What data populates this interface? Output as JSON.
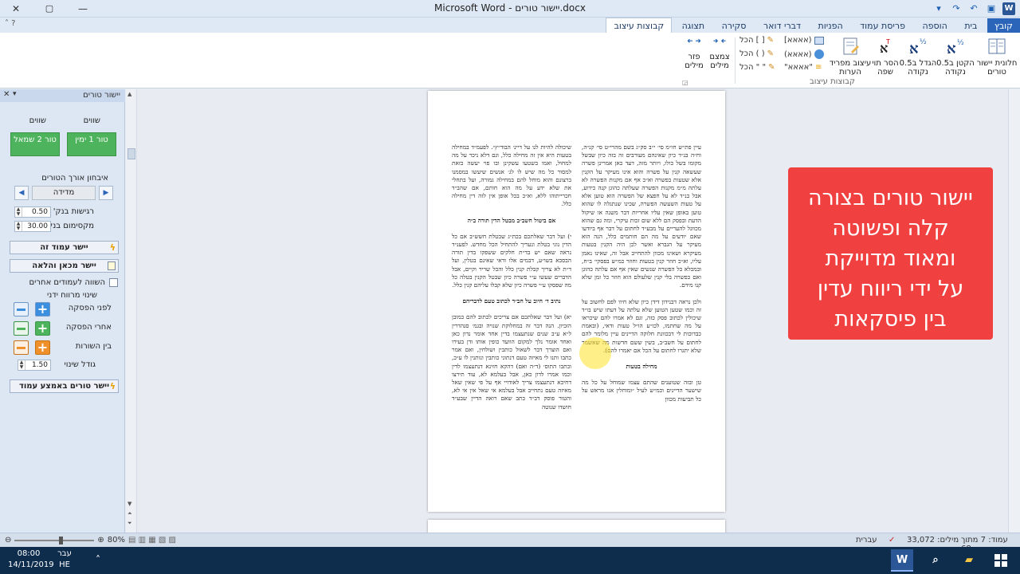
{
  "window": {
    "title_file": "יישור טורים.docx",
    "title_app": "Microsoft Word",
    "close": "✕",
    "maximize": "▢",
    "minimize": "—"
  },
  "ribbon_tabs": [
    "קובץ",
    "בית",
    "הוספה",
    "פריסת עמוד",
    "הפניות",
    "דברי דואר",
    "סקירה",
    "תצוגה",
    "קבוצות עיצוב"
  ],
  "active_tab": "קבוצות עיצוב",
  "ribbon": {
    "buttons": [
      {
        "label": "חלונית יישור טורים"
      },
      {
        "label": "הקטן ב0.5 נקודה"
      },
      {
        "label": "הגדל ב0.5 נקודה"
      },
      {
        "label": "הסר תוי שפה"
      },
      {
        "label": "עיצוב מפריד הערות"
      }
    ],
    "small": [
      {
        "label": "(אאאא]"
      },
      {
        "label": "(אאאא)"
      },
      {
        "label": "\"אאאא\""
      },
      {
        "label": "[ ] הכל"
      },
      {
        "label": "( ) הכל"
      },
      {
        "label": "\" \" הכל"
      }
    ],
    "group_label": "קבוצות עיצוב",
    "spacing_buttons": [
      {
        "label": "צמצם מילים"
      },
      {
        "label": "פזר מילים"
      }
    ]
  },
  "pane": {
    "title": "יישור טורים",
    "col_labels": [
      "שווים",
      "שווים"
    ],
    "green_buttons": [
      "טור 1 ימין",
      "טור 2 שמאל"
    ],
    "balance_label": "איבחון אורך הטורים",
    "nav_value": "מדידה",
    "sensitivity_label": "רגישות בנק'",
    "sensitivity_value": "0.50",
    "max_label": "מקסימום בנק'",
    "max_value": "30.00",
    "align_page_btn": "יישר עמוד זה",
    "align_cursor_btn": "יישר מכאן והלאה",
    "compare_label": "השווה לעמודים אחרים",
    "change_label": "שינוי מרווח ידני",
    "before_para": "לפני הפסקה",
    "after_para": "אחרי הפסקה",
    "between_lines": "בין השורות",
    "change_size_label": "גודל שינוי",
    "change_size_value": "1.50",
    "align_mid_btn": "יישר טורים באמצע עמוד"
  },
  "document": {
    "right_col": [
      "עיין פת״ש חו״מ סי׳ י״ב סק״ג בשם מהרי״ט סי׳ קנ״ה, וח״ה בנ״ד כיון שאינהם מעורבים זה בזה כיון שבשל מקומו בשל כולו, ויותר מזה, דעד כאן אמרינן פשרה שעשאה קנין על פשרה והוא אינו מעיקר על הקנין אלא שטעות בפשרה וא״כ אף אם מקנות הפשרה לא עלתה מ״מ מקנות הפשרה שעלתה כהוגן קנה כידוע, אבל בנ״ד לא על חפצא של הפשרה הוא טוען אלא על טעות השעשה הפשרה, שכינו שנתגלה לו שהוא טוען באופן שאין עליו אחריות דבר משנה או שיקול הדעת ובפסק הם ללא שום זכות עיקרי, ומה גם שהוא מכוונל להעריים על מבע״ד לחתום על דבר אף ביודעו שאם יודעים על מה הם חותמים כלל, הנה הוא מעיקר על הגברא ואשר לכן היה הקנין בטעות מעיקרא ושאינו מכוון להתחייב אבל זה, שאינו נאמן עליו, וא״כ חוזר קנין בטעות וחוזר כמ״ש בפסקי׳ ב״ח, ובמכלא כל הפשרה שנשים שאין אף אם עלתה כהוגן ואם כפשרה בלי קנין שלעולם הוא חוזר כל זמן שלא קנו מידם.",
      "ולכן נראה דבנידון דידן כיון שלא חיוו לפם לחשוב על זה וכמו שטען הטוען שלא עלתה על דעתו שיש בו״ד שיכולין לכתוב פסק כזה, וגם לא אמרו להם שיכראו על מה שחתמו, לכו״ע הו״ל טעות ודאי, (ובאמת כבדוכות לי דבכוונת חלוקה הדיינים עיין מלומר להם לחתום על חשב״ב, בשין ששם חדשות מה שאשמר שלא יתגרו לחתום על הכל אם יאמרו להם).",
      "מחילה בטעות",
      "טן ובזה שטוענים שהתם עצמו שמוחל על כל מה שישער הדיינים וכמ״ש לעיל ״ומוחלין אנו מראש על כל תביעות מכוון"
    ],
    "left_col": [
      "שיכולה להיות לנו על דיינ׳ הבוד״ץ״. לפעמ״ד במחילה בטעות היא אין זה מחילה כלל, וגם דלא ניכר על מה למחול, ואמו בשטעו עשקינן ובו פוי יעשה כזאת למסור כל מה שיש לו לג׳ אנשים שיעשו במסמנו ברצונם והוא מוחל להם במחילה גמורה, ועל בתחלי את שלא ידע על מה הוא חותם, אם שהב״ד חכרייתוהו ללא, וא״כ בכל אופן אין לזה דין מחילה כלל.",
      "אם ביטול חשב״ב מבטל הדין תורה ב״ה",
      "י) ועל דבר שאלתכם בכת״ג שבטלת חשש״ב אם כל הדין נוגי בטלת ונעריך להתחיל הכל מחדש. לפענ״ד נראה שאם יש בד״ת חלקים ששפקו בדין תורה הבסכא בשו״ע, דבמים אלו ודאי שאינם בטלין, ועל ד״ת לא צריך קבלת קנין כלל והכל שריר וקיים, אבל הדברים שעשו ע״י פשרה כיון שבטל הקנין בטלה כל מה שפסקו ע״י פשרה כיון שלא קבלו עליהם קנין כלל.",
      "נתיב ד׳ חיוב על חב״ד לכתוב טעם לדבריהם",
      "יא) ועל דבר שאלתכם אם צריכים לכתוב להם כמובן הזכיון. הנה דבר זה במחלוקת שנויה ובגמ׳ סנהדרין ל״א ע״ב שנים שנתעצמו בדין אחד אומר נדון כאן ואחד אומר נלך למקום הוועד כופין אותו ודן בעירו ואם הוצרך דבר לשאול כותבין ושולחין, ואם אמר כתבו ותנו לי מאיזה טעם דנתוני כותבין ונותנין לו ע״כ, ובתבו התוס׳ (ד״ה ואם) דהקא חזינא דנתעצמו לדין וכמו אמרו לדון כאן, אבל בעלמא לא, עוד תירצו דחיכא דנתעצמו צריך לאודויי אף על פי שאין שאל מאיזה טעם נתחייב אבל בעלמא אי שאל אין אי לא, והטור פוסק דב״ד כתב שאם רואה הדיין שבע״ד חושדו שנוטה"
    ]
  },
  "overlay": {
    "lines": [
      "יישור טורים בצורה",
      "קלה ופשוטה",
      "ומאוד מדוייקת",
      "על ידי ריווח עדין",
      "בין פיסקאות"
    ]
  },
  "status": {
    "page": "עמוד: 7 מתוך 68",
    "words": "מילים: 33,072",
    "lang": "עברית",
    "zoom": "80%"
  },
  "taskbar": {
    "time": "08:00",
    "date": "14/11/2019",
    "lang_top": "עבר",
    "lang_bottom": "HE",
    "word_app": "W"
  },
  "colors": {
    "overlay": "#f04040",
    "green_button": "#4db35c",
    "file_tab": "#2b65b9",
    "taskbar": "#0e2d4d"
  }
}
